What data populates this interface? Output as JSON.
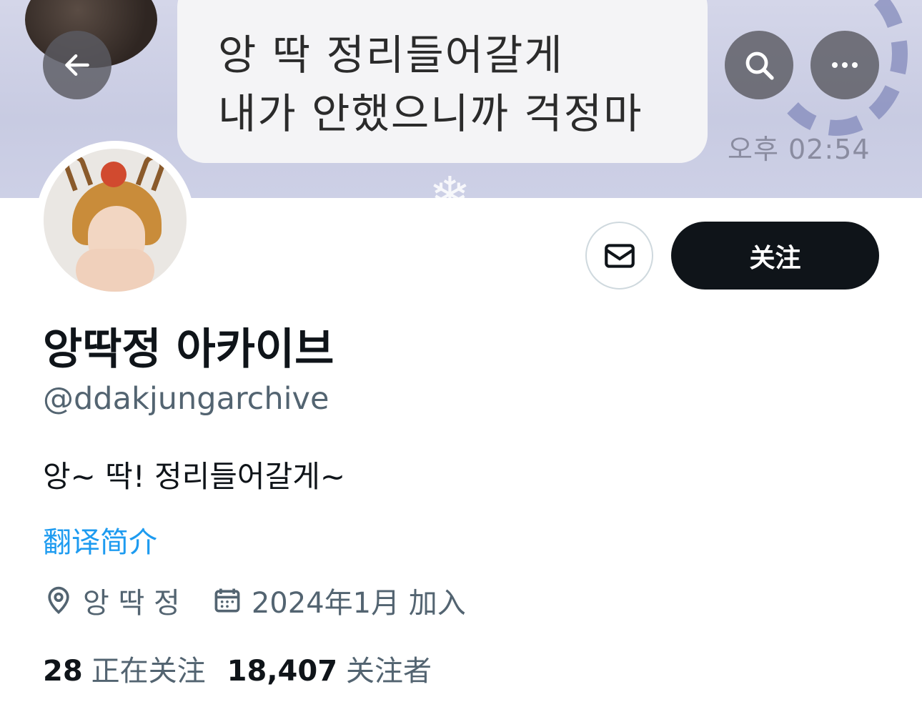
{
  "banner": {
    "chat_line_1": "앙 딱 정리들어갈게",
    "chat_line_2": "내가 안했으니까 걱정마",
    "chat_time": "오후 02:54"
  },
  "header": {
    "back_icon": "arrow-left-icon",
    "search_icon": "search-icon",
    "more_icon": "more-horizontal-icon"
  },
  "actions": {
    "message_icon": "envelope-icon",
    "follow_label": "关注"
  },
  "profile": {
    "display_name": "앙딱정 아카이브",
    "handle": "@ddakjungarchive",
    "bio": "앙~ 딱! 정리들어갈게~",
    "translate_label": "翻译简介",
    "location": "앙 딱 정",
    "joined": "2024年1月 加入"
  },
  "stats": {
    "following_count": "28",
    "following_label": "正在关注",
    "followers_count": "18,407",
    "followers_label": "关注者"
  },
  "colors": {
    "accent": "#1d9bf0",
    "primary_text": "#0f1419",
    "secondary_text": "#536471",
    "follow_button_bg": "#0f1419"
  }
}
